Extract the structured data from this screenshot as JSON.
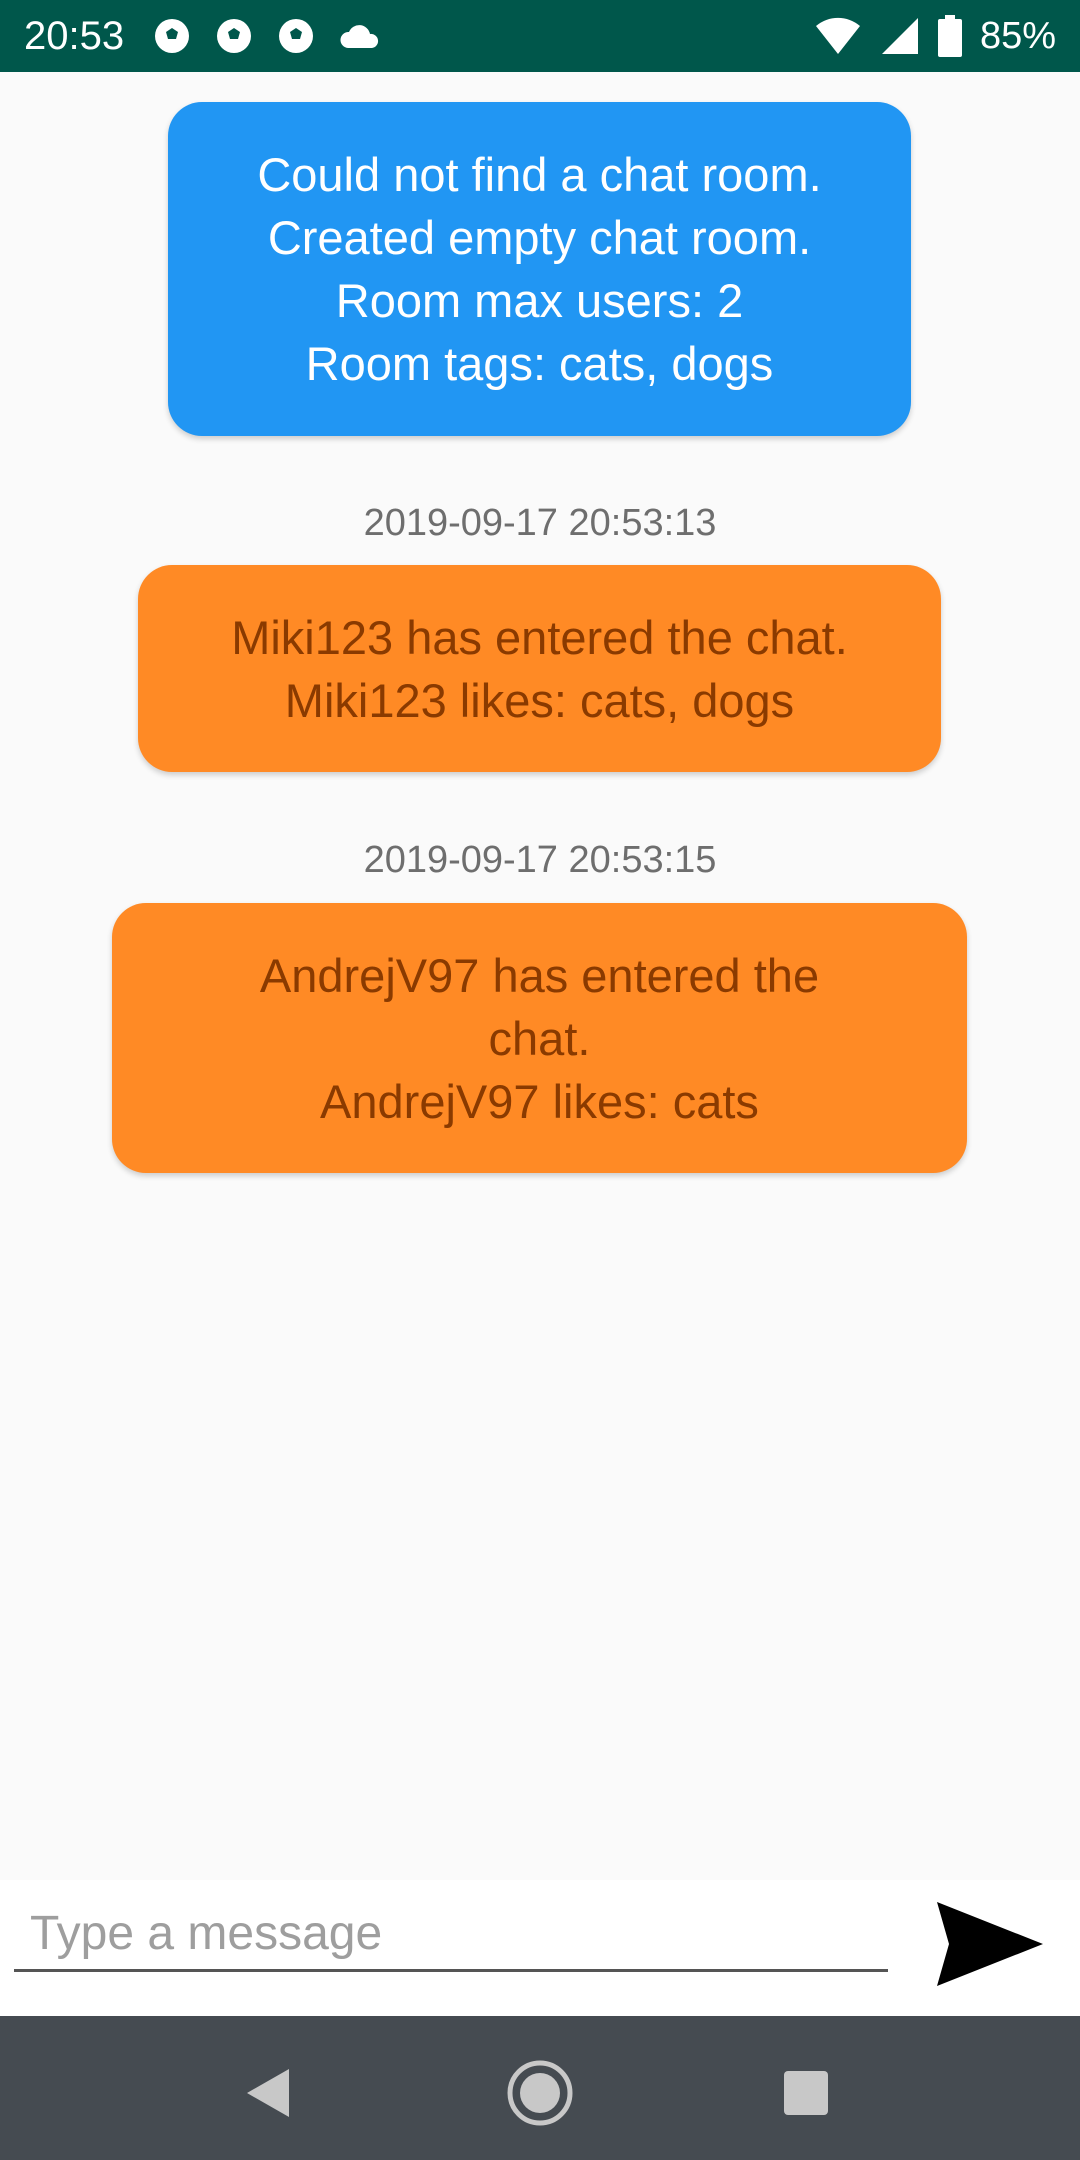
{
  "status_bar": {
    "time": "20:53",
    "battery": "85%",
    "icons": [
      "soccer-ball-icon",
      "soccer-ball-icon",
      "soccer-ball-icon",
      "cloud-icon",
      "wifi-icon",
      "signal-icon",
      "battery-icon"
    ]
  },
  "messages": [
    {
      "type": "system",
      "text": "Could not find a chat room.\nCreated empty chat room.\nRoom max users: 2\nRoom tags: cats, dogs"
    },
    {
      "type": "join",
      "timestamp": "2019-09-17 20:53:13",
      "text": "Miki123 has entered the chat.\nMiki123 likes: cats, dogs"
    },
    {
      "type": "join",
      "timestamp": "2019-09-17 20:53:15",
      "text": "AndrejV97 has entered the\nchat.\nAndrejV97 likes: cats"
    }
  ],
  "input": {
    "placeholder": "Type a message",
    "value": ""
  },
  "colors": {
    "status_bar": "#00574b",
    "system_bubble": "#2196f3",
    "join_bubble": "#ff8a25",
    "nav_bar": "#454b51"
  },
  "nav_bar": {
    "icons": [
      "back-icon",
      "home-icon",
      "recents-icon"
    ]
  }
}
